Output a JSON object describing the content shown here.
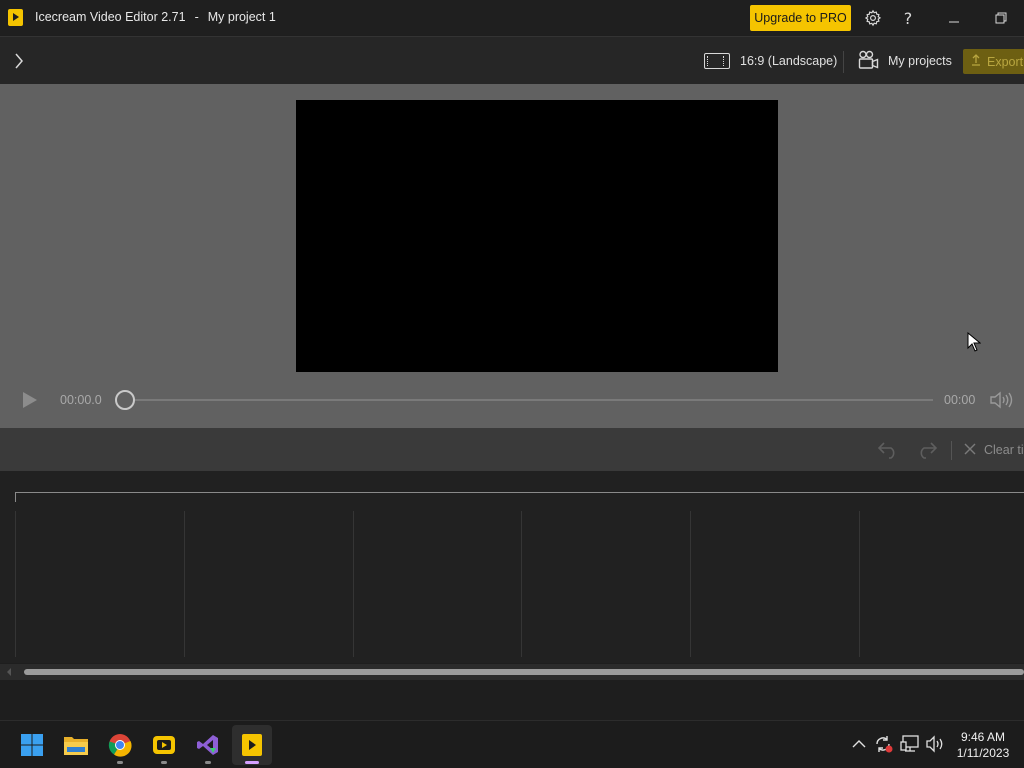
{
  "window": {
    "app_name": "Icecream Video Editor 2.71",
    "separator": "-",
    "project_name": "My project 1",
    "upgrade_label": "Upgrade to PRO"
  },
  "toolbar": {
    "aspect_ratio_label": "16:9 (Landscape)",
    "my_projects_label": "My projects",
    "export_label": "Export"
  },
  "player": {
    "current_time": "00:00.0",
    "total_time": "00:00",
    "progress": 0
  },
  "edit_bar": {
    "clear_label": "Clear ti"
  },
  "taskbar": {
    "apps": [
      "windows-start",
      "file-explorer",
      "google-chrome",
      "screen-recorder",
      "visual-studio",
      "icecream-video-editor"
    ],
    "active_app": "icecream-video-editor",
    "time": "9:46 AM",
    "date": "1/11/2023"
  },
  "colors": {
    "accent": "#f5c400",
    "preview_bg": "#616161",
    "timeline_bg": "#212121"
  }
}
